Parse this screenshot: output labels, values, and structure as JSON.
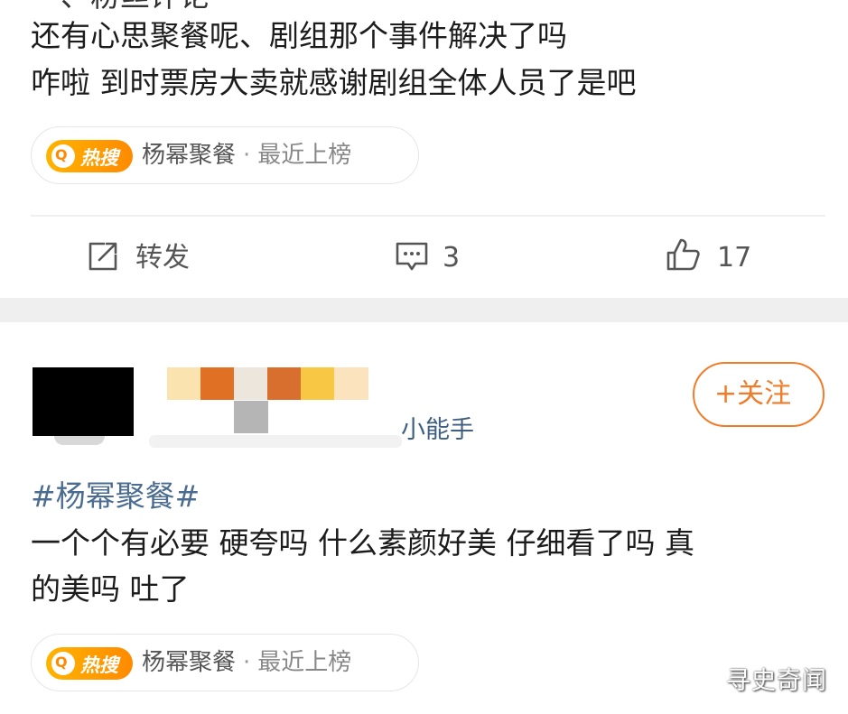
{
  "post1": {
    "truncated_line": "一、粉丝评论",
    "lines": [
      "还有心思聚餐呢、剧组那个事件解决了吗",
      "咋啦 到时票房大卖就感谢剧组全体人员了是吧"
    ],
    "hot_search": {
      "badge": "热搜",
      "badge_icon": "search-icon",
      "topic": "杨幂聚餐",
      "separator": "·",
      "status": "最近上榜"
    },
    "actions": {
      "repost_label": "转发",
      "repost_icon": "share-icon",
      "comment_count": "3",
      "comment_icon": "comment-icon",
      "like_count": "17",
      "like_icon": "thumbs-up-icon"
    }
  },
  "post2": {
    "username_suffix": "小能手",
    "follow_label": "+关注",
    "hashtag": "#杨幂聚餐#",
    "lines": [
      "一个个有必要 硬夸吗 什么素颜好美 仔细看了吗 真",
      "的美吗 吐了"
    ],
    "hot_search": {
      "badge": "热搜",
      "badge_icon": "search-icon",
      "topic": "杨幂聚餐",
      "separator": "·",
      "status": "最近上榜"
    }
  },
  "watermark": "寻史奇闻",
  "colors": {
    "link_blue": "#4a6c91",
    "follow_orange": "#f07c2a",
    "hot_orange": "#ff8a00",
    "divider_gray": "#efefef"
  },
  "mosaic_colors": [
    "#fbe3b0",
    "#e07024",
    "#ece6dc",
    "#d86f2e",
    "#f8c844",
    "#fbe3bd"
  ]
}
